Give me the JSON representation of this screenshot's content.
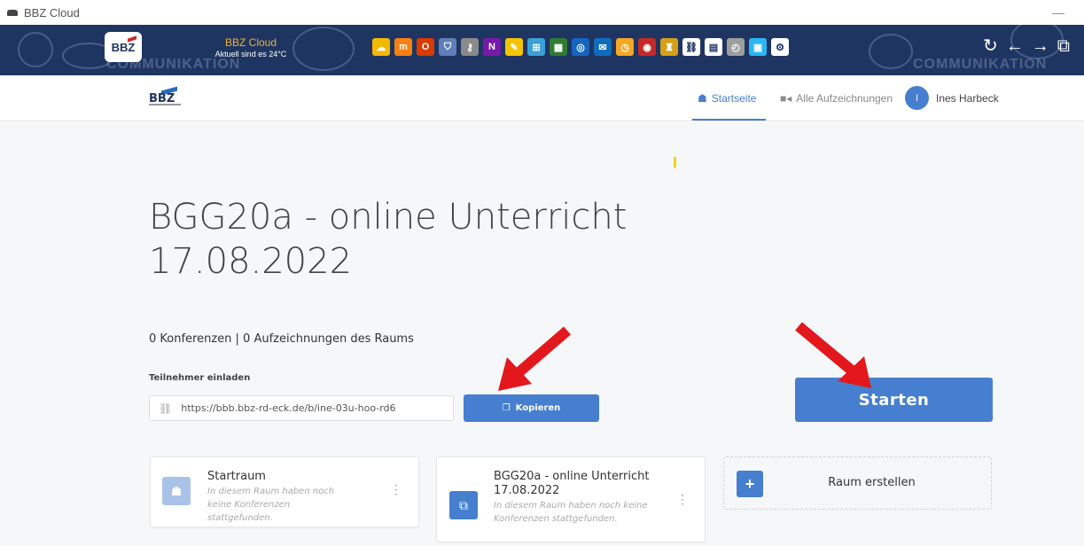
{
  "window": {
    "title": "BBZ Cloud",
    "minimize_label": "—"
  },
  "banner": {
    "logo_text": "BBZ",
    "brand_name": "BBZ Cloud",
    "weather": "Aktuell sind es 24°C",
    "watermark": "COMMUNIKATION",
    "apps": [
      {
        "icon": "cloud-icon",
        "color": "#f5b800",
        "glyph": "☁"
      },
      {
        "icon": "moodle-icon",
        "color": "#f98012",
        "glyph": "m"
      },
      {
        "icon": "office-icon",
        "color": "#d83b01",
        "glyph": "O"
      },
      {
        "icon": "shield-icon",
        "color": "#5f7fb8",
        "glyph": "⛉"
      },
      {
        "icon": "key-icon",
        "color": "#8a8a8a",
        "glyph": "⚷"
      },
      {
        "icon": "onenote-icon",
        "color": "#7719aa",
        "glyph": "N"
      },
      {
        "icon": "notes-icon",
        "color": "#f5c400",
        "glyph": "✎"
      },
      {
        "icon": "sitemap-icon",
        "color": "#3aa0d8",
        "glyph": "⊞"
      },
      {
        "icon": "board-icon",
        "color": "#2e7d32",
        "glyph": "▦"
      },
      {
        "icon": "target-icon",
        "color": "#1565c0",
        "glyph": "◎"
      },
      {
        "icon": "outlook-icon",
        "color": "#0f6cbd",
        "glyph": "✉"
      },
      {
        "icon": "clock-icon",
        "color": "#f5a623",
        "glyph": "◷"
      },
      {
        "icon": "webuntis-icon",
        "color": "#c62828",
        "glyph": "◉"
      },
      {
        "icon": "coat-of-arms-icon",
        "color": "#d4a017",
        "glyph": "♜"
      },
      {
        "icon": "link-icon",
        "color": "#ffffff",
        "glyph": "⛓"
      },
      {
        "icon": "book-icon",
        "color": "#ffffff",
        "glyph": "▤"
      },
      {
        "icon": "compass-icon",
        "color": "#9e9e9e",
        "glyph": "◴"
      },
      {
        "icon": "screen-icon",
        "color": "#29b6f6",
        "glyph": "▣"
      },
      {
        "icon": "settings-icon",
        "color": "#ffffff",
        "glyph": "⚙"
      }
    ],
    "nav": [
      {
        "icon": "reload-icon",
        "glyph": "↻"
      },
      {
        "icon": "back-icon",
        "glyph": "←"
      },
      {
        "icon": "forward-icon",
        "glyph": "→"
      },
      {
        "icon": "copy-window-icon",
        "glyph": "⧉"
      }
    ]
  },
  "header": {
    "site_logo": "BBZ",
    "nav_home": "Startseite",
    "nav_recordings": "Alle Aufzeichnungen",
    "user_initial": "I",
    "user_name": "Ines Harbeck",
    "accent_color": "#467fcf"
  },
  "room": {
    "title": "BGG20a - online Unterricht 17.08.2022",
    "stats": "0 Konferenzen | 0 Aufzeichnungen des Raums",
    "invite_label": "Teilnehmer einladen",
    "invite_url": "https://bbb.bbz-rd-eck.de/b/ine-03u-hoo-rd6",
    "copy_label": "Kopieren",
    "start_label": "Starten"
  },
  "cards": [
    {
      "title": "Startraum",
      "subtitle": "In diesem Raum haben noch keine Konferenzen stattgefunden.",
      "icon": "home-icon"
    },
    {
      "title": "BGG20a - online Unterricht 17.08.2022",
      "subtitle": "In diesem Raum haben noch keine Konferenzen stattgefunden.",
      "icon": "presentation-icon"
    }
  ],
  "create_room_label": "Raum erstellen",
  "annotation_color": "#e3171c"
}
